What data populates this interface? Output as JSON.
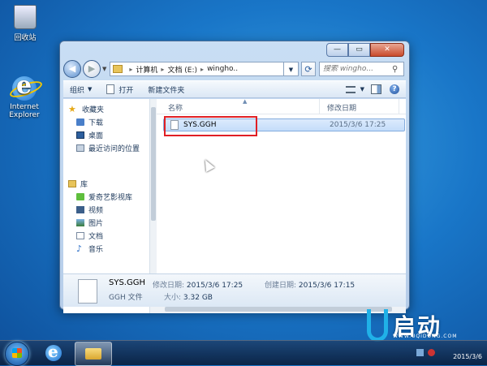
{
  "desktop": {
    "recycle_bin": "回收站",
    "ie": "Internet Explorer"
  },
  "window": {
    "caption_min": "—",
    "caption_max": "▭",
    "caption_close": "✕",
    "address": [
      "计算机",
      "文档 (E:)",
      "wingho.."
    ],
    "search_placeholder": "搜索 wingho...",
    "toolbar": {
      "organize": "组织",
      "open": "打开",
      "new_folder": "新建文件夹"
    },
    "nav": {
      "favorites": "收藏夹",
      "favorites_items": [
        "下载",
        "桌面",
        "最近访问的位置"
      ],
      "libraries": "库",
      "library_items": [
        "爱奇艺影视库",
        "视频",
        "图片",
        "文档",
        "音乐"
      ]
    },
    "columns": {
      "name": "名称",
      "date": "修改日期"
    },
    "files": [
      {
        "name": "SYS.GGH",
        "date": "2015/3/6 17:25"
      }
    ],
    "details": {
      "name": "SYS.GGH",
      "type": "GGH 文件",
      "modified_label": "修改日期:",
      "modified_value": "2015/3/6 17:25",
      "created_label": "创建日期:",
      "created_value": "2015/3/6 17:15",
      "size_label": "大小:",
      "size_value": "3.32 GB"
    }
  },
  "taskbar": {
    "date": "2015/3/6"
  },
  "watermark": {
    "text": "启动",
    "url": "WWW.UQIDONG.COM"
  },
  "colors": {
    "selection_highlight": "#e01f24",
    "accent": "#20b1e8"
  }
}
